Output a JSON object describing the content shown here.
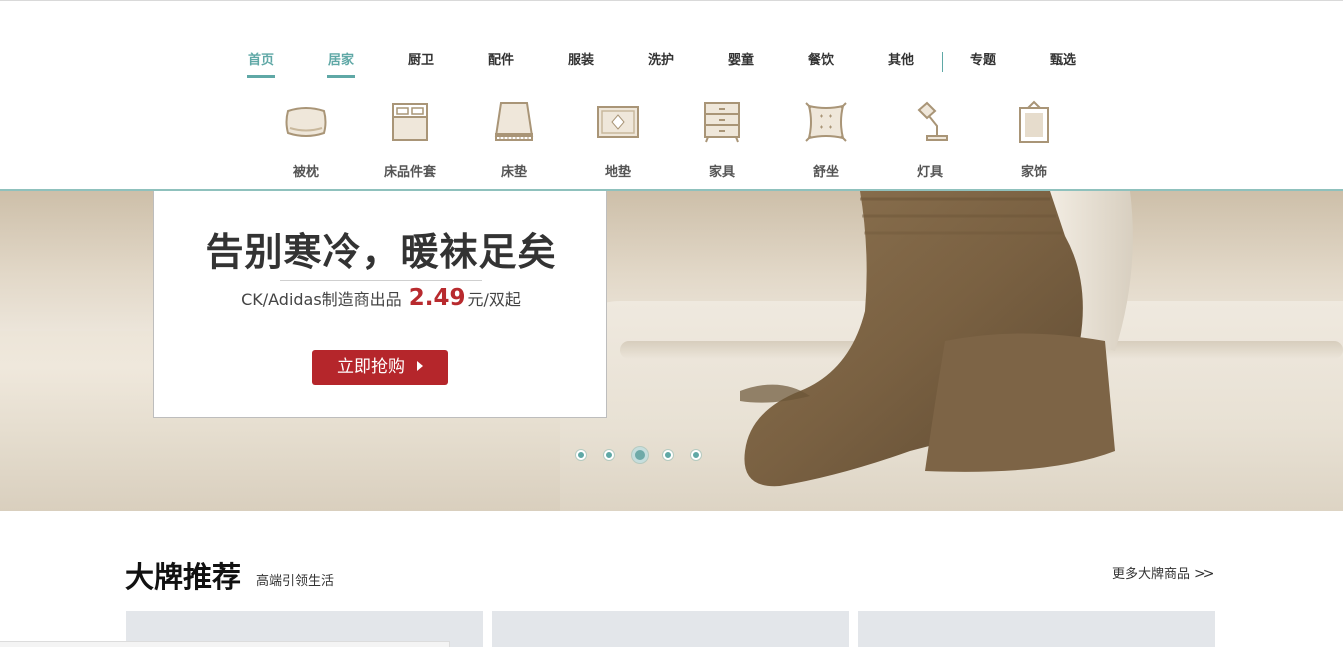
{
  "nav": {
    "items": [
      {
        "label": "首页",
        "active": true
      },
      {
        "label": "居家",
        "active": true
      },
      {
        "label": "厨卫",
        "active": false
      },
      {
        "label": "配件",
        "active": false
      },
      {
        "label": "服装",
        "active": false
      },
      {
        "label": "洗护",
        "active": false
      },
      {
        "label": "婴童",
        "active": false
      },
      {
        "label": "餐饮",
        "active": false
      },
      {
        "label": "其他",
        "active": false
      },
      {
        "label": "专题",
        "active": false
      },
      {
        "label": "甄选",
        "active": false
      }
    ],
    "accent_color": "#5fa8a6"
  },
  "subnav": {
    "items": [
      {
        "label": "被枕",
        "icon": "pillow-icon"
      },
      {
        "label": "床品件套",
        "icon": "bedding-set-icon"
      },
      {
        "label": "床垫",
        "icon": "mattress-icon"
      },
      {
        "label": "地垫",
        "icon": "floor-mat-icon"
      },
      {
        "label": "家具",
        "icon": "cabinet-icon"
      },
      {
        "label": "舒坐",
        "icon": "cushion-icon"
      },
      {
        "label": "灯具",
        "icon": "lamp-icon"
      },
      {
        "label": "家饰",
        "icon": "frame-icon"
      }
    ],
    "icon_color": "#a99577"
  },
  "banner": {
    "title": "告别寒冷，暖袜足矣",
    "subtitle_prefix": "CK/Adidas制造商出品",
    "price": "2.49",
    "subtitle_suffix": "元/双起",
    "button_label": "立即抢购",
    "button_color": "#b5262b",
    "slides_total": 5,
    "active_slide": 3
  },
  "brands": {
    "title": "大牌推荐",
    "subtitle": "高端引领生活",
    "more_label": "更多大牌商品",
    "more_chevron": ">>"
  }
}
